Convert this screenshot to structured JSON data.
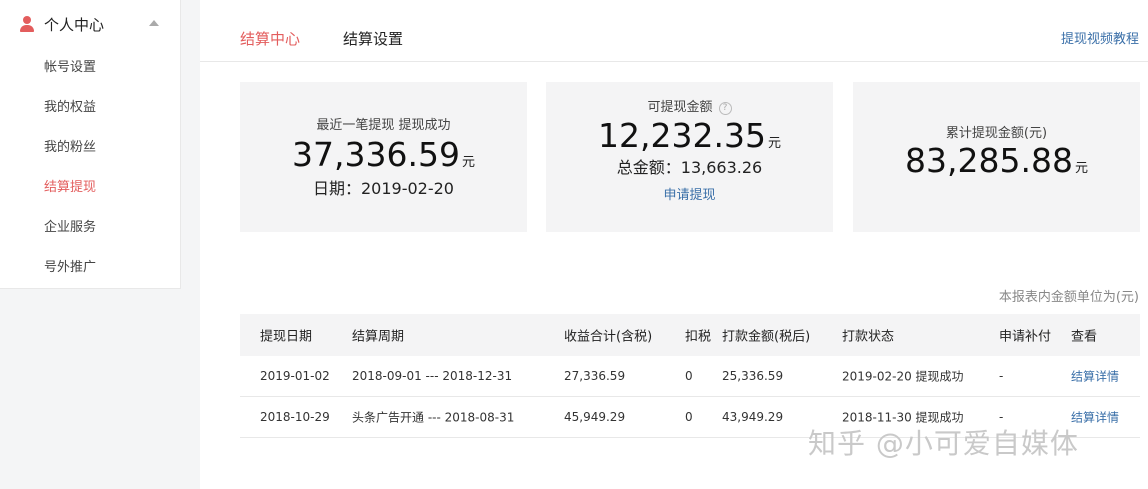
{
  "sidebar": {
    "title": "个人中心",
    "items": [
      {
        "label": "帐号设置",
        "active": false
      },
      {
        "label": "我的权益",
        "active": false
      },
      {
        "label": "我的粉丝",
        "active": false
      },
      {
        "label": "结算提现",
        "active": true
      },
      {
        "label": "企业服务",
        "active": false
      },
      {
        "label": "号外推广",
        "active": false
      }
    ]
  },
  "tabs": {
    "items": [
      {
        "label": "结算中心",
        "active": true
      },
      {
        "label": "结算设置",
        "active": false
      }
    ],
    "tutorial_link": "提现视频教程"
  },
  "cards": {
    "latest": {
      "label": "最近一笔提现 提现成功",
      "amount": "37,336.59",
      "unit": "元",
      "date": "日期：2019-02-20"
    },
    "available": {
      "label": "可提现金额",
      "help_icon": "?",
      "amount": "12,232.35",
      "unit": "元",
      "total": "总金额：13,663.26",
      "apply_link": "申请提现"
    },
    "cumulative": {
      "label": "累计提现金额(元)",
      "amount": "83,285.88",
      "unit": "元"
    }
  },
  "table": {
    "note": "本报表内金额单位为(元)",
    "headers": [
      "提现日期",
      "结算周期",
      "收益合计(含税)",
      "扣税",
      "打款金额(税后)",
      "打款状态",
      "申请补付",
      "查看"
    ],
    "rows": [
      [
        "2019-01-02",
        "2018-09-01 --- 2018-12-31",
        "27,336.59",
        "0",
        "25,336.59",
        "2019-02-20 提现成功",
        "-",
        "结算详情"
      ],
      [
        "2018-10-29",
        "头条广告开通 --- 2018-08-31",
        "45,949.29",
        "0",
        "43,949.29",
        "2018-11-30 提现成功",
        "-",
        "结算详情"
      ]
    ]
  },
  "watermark": "知乎 @小可爱自媒体",
  "colors": {
    "accent": "#e35d5d",
    "link": "#3a6fa8",
    "card_bg": "#f4f4f5"
  }
}
